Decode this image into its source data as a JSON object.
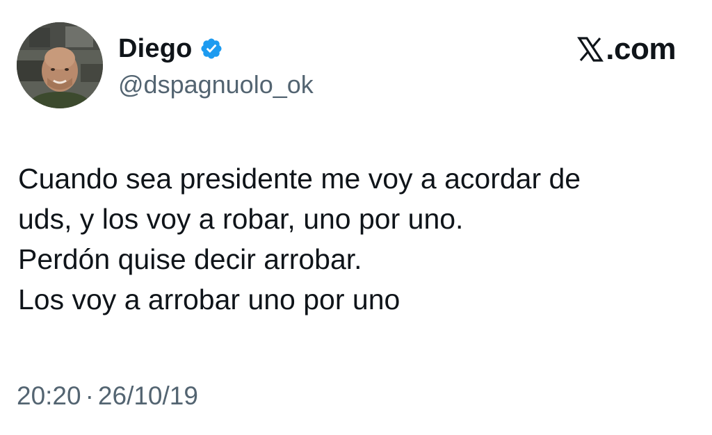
{
  "author": {
    "display_name": "Diego",
    "handle": "@dspagnuolo_ok",
    "verified": true,
    "avatar_icon": "profile-photo-avatar"
  },
  "brand": {
    "logo_icon": "x-logo-icon",
    "text": "X.com"
  },
  "tweet": {
    "lines": [
      "Cuando sea presidente me voy a acordar de",
      "uds, y los voy a robar, uno por uno.",
      "Perdón quise decir arrobar.",
      "Los voy a arrobar uno por uno"
    ]
  },
  "meta": {
    "time": "20:20",
    "separator": "·",
    "date": "26/10/19"
  },
  "colors": {
    "text": "#0f1419",
    "secondary_text": "#536471",
    "verified_blue": "#1d9bf0",
    "background": "#ffffff"
  }
}
